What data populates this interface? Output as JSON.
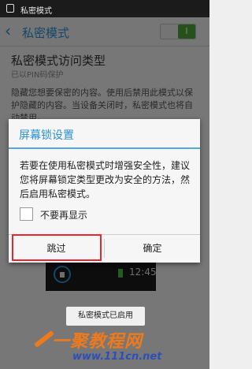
{
  "status_bar": {
    "title": "私密模式"
  },
  "action_bar": {
    "title": "私密模式",
    "toggle_state": "I"
  },
  "settings": {
    "section_title": "私密模式访问类型",
    "section_subtitle": "已以PIN码保护",
    "description": "隐藏您想要保密的内容。使用后禁用此模式以保护隐藏的内容。当设备关闭时，私密模式也将自动禁用。"
  },
  "dialog": {
    "title": "屏幕锁设置",
    "message": "若要在使用私密模式时增强安全性，建议您将屏幕锁定类型更改为安全的方法，然后启用私密模式。",
    "checkbox_label": "不要再显示",
    "checkbox_checked": false,
    "skip_button": "跳过",
    "ok_button": "确定"
  },
  "preview": {
    "time": "12:45"
  },
  "toast": "私密模式已启用",
  "watermark": {
    "title": "一聚教程网",
    "url": "www.111cn.net"
  },
  "colors": {
    "accent": "#2a8fd6",
    "highlight": "#e8262d",
    "toggle_on": "#4aa33a"
  }
}
